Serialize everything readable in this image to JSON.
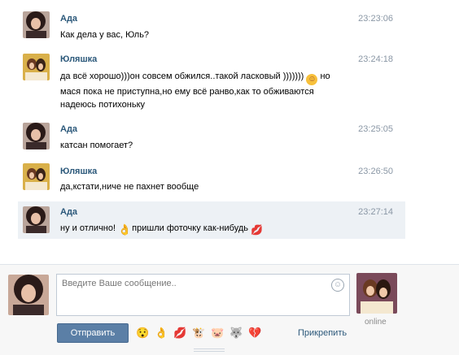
{
  "messages": [
    {
      "author": "Ада",
      "time": "23:23:06",
      "lines": [
        "Как дела у вас, Юль?"
      ]
    },
    {
      "author": "Юляшка",
      "time": "23:24:18",
      "line1_a": "да всё хорошо)))он совсем обжился..такой ласковый )))))))",
      "line1_b": "но",
      "lines_rest": [
        "мася пока не приступна,но ему всё ранво,как то обживаются",
        "надеюсь потихоньку"
      ]
    },
    {
      "author": "Ада",
      "time": "23:25:05",
      "lines": [
        "катсан помогает?"
      ]
    },
    {
      "author": "Юляшка",
      "time": "23:26:50",
      "lines": [
        "да,кстати,ниче не пахнет вообще"
      ]
    },
    {
      "author": "Ада",
      "time": "23:27:14",
      "part_a": "ну и отлично!",
      "part_b": "пришли фоточку как-нибудь"
    }
  ],
  "composer": {
    "placeholder": "Введите Ваше сообщение..",
    "send_label": "Отправить",
    "attach_label": "Прикрепить",
    "online_label": "online",
    "emoji_bar": [
      "😯",
      "👌",
      "💋",
      "🐮",
      "🐷",
      "🐺",
      "💔"
    ]
  },
  "colors": {
    "author": "#2b587a",
    "time": "#8a97a5",
    "highlight": "#edf1f5",
    "send_button": "#5b7fa6"
  }
}
